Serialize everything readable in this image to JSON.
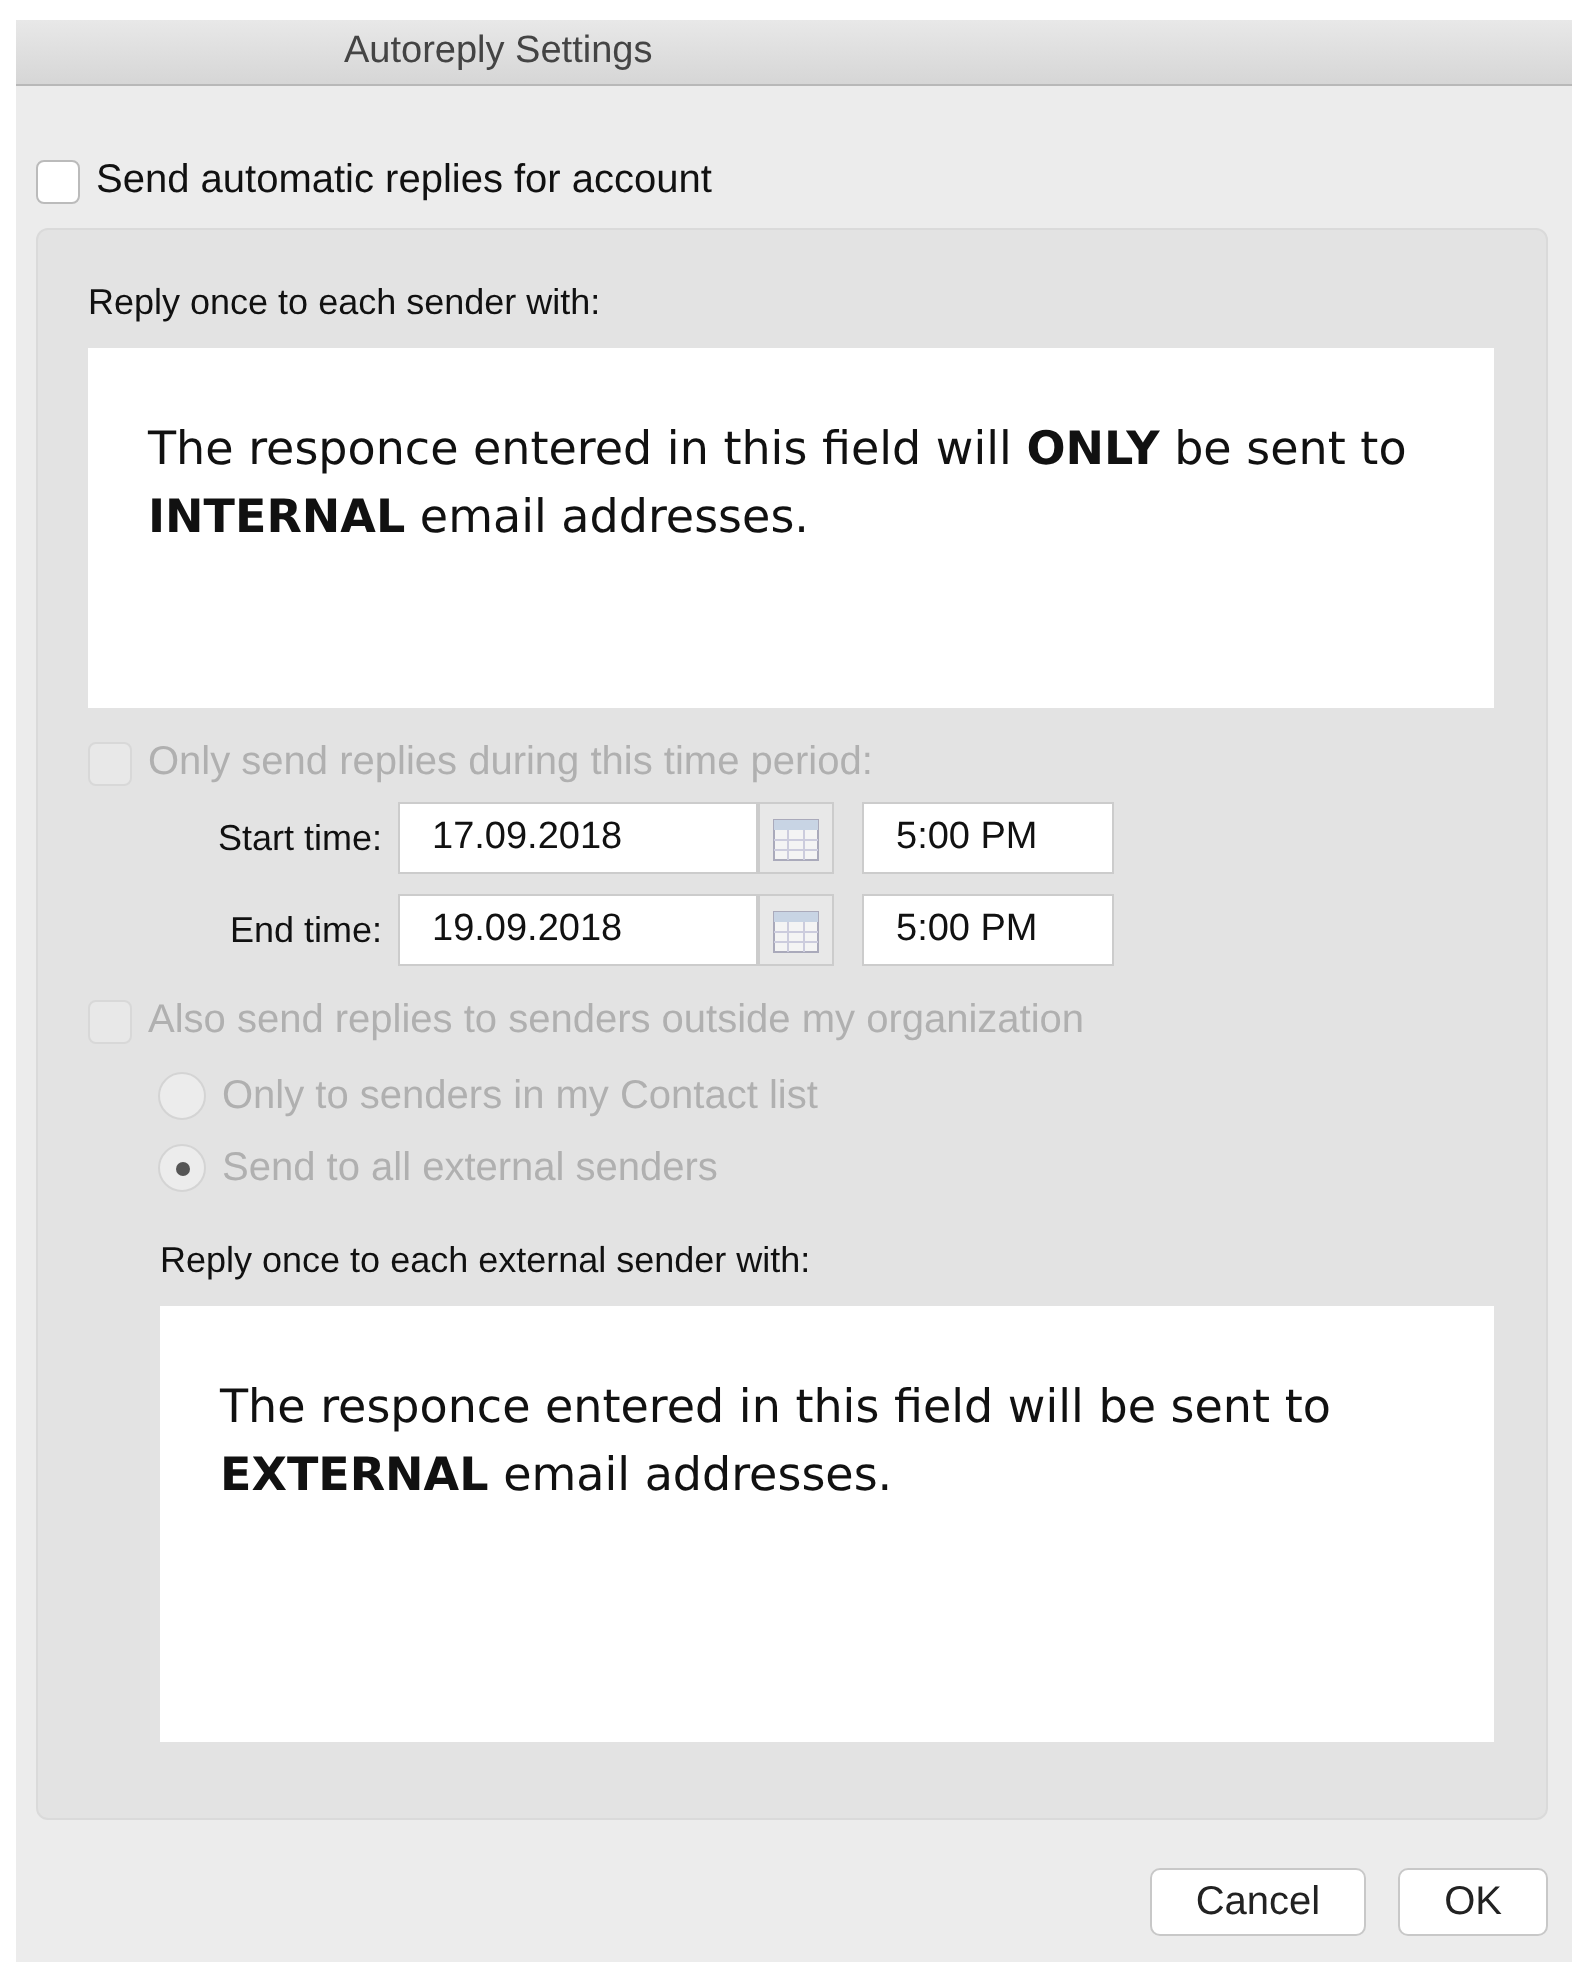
{
  "window": {
    "title": "Autoreply Settings"
  },
  "auto_reply": {
    "label": "Send automatic replies for account",
    "checked": false
  },
  "internal_reply": {
    "label": "Reply once to each sender with:",
    "message": "The responce entered in this field will **ONLY** be sent to **INTERNAL** email addresses."
  },
  "time_period": {
    "label": "Only send replies during this time period:",
    "checked": false,
    "disabled": true,
    "rows": [
      {
        "label": "Start time:",
        "date": "17.09.2018",
        "time": "5:00 PM"
      },
      {
        "label": "End time:",
        "date": "19.09.2018",
        "time": "5:00 PM"
      }
    ]
  },
  "external": {
    "label": "Also send replies to senders outside my organization",
    "checked": false,
    "disabled": true,
    "options": [
      {
        "label": "Only to senders in my Contact list",
        "selected": false
      },
      {
        "label": "Send to all external senders",
        "selected": true
      }
    ],
    "reply_label": "Reply once to each external sender with:",
    "message": "The responce entered in this field will be sent to **EXTERNAL** email addresses."
  },
  "buttons": [
    "Cancel",
    "OK"
  ]
}
